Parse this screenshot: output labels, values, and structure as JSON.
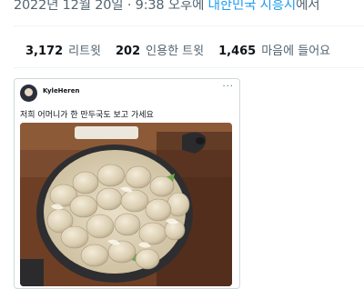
{
  "header": {
    "timestamp_prefix": "2022년 12월 20일 · 9:38 오후에 ",
    "location": "대한민국 시흥시",
    "location_suffix": "에서"
  },
  "stats": {
    "retweets_count": "3,172",
    "retweets_label": "리트윗",
    "quotes_count": "202",
    "quotes_label": "인용한 트윗",
    "likes_count": "1,465",
    "likes_label": "마음에 들어요"
  },
  "quoted_tweet": {
    "handle": "KyleHeren",
    "more_icon": "more-dots-icon",
    "text": "저희 어머니가 한 만두국도 보고 가세요",
    "image": "dumpling-soup-pot-photo"
  }
}
